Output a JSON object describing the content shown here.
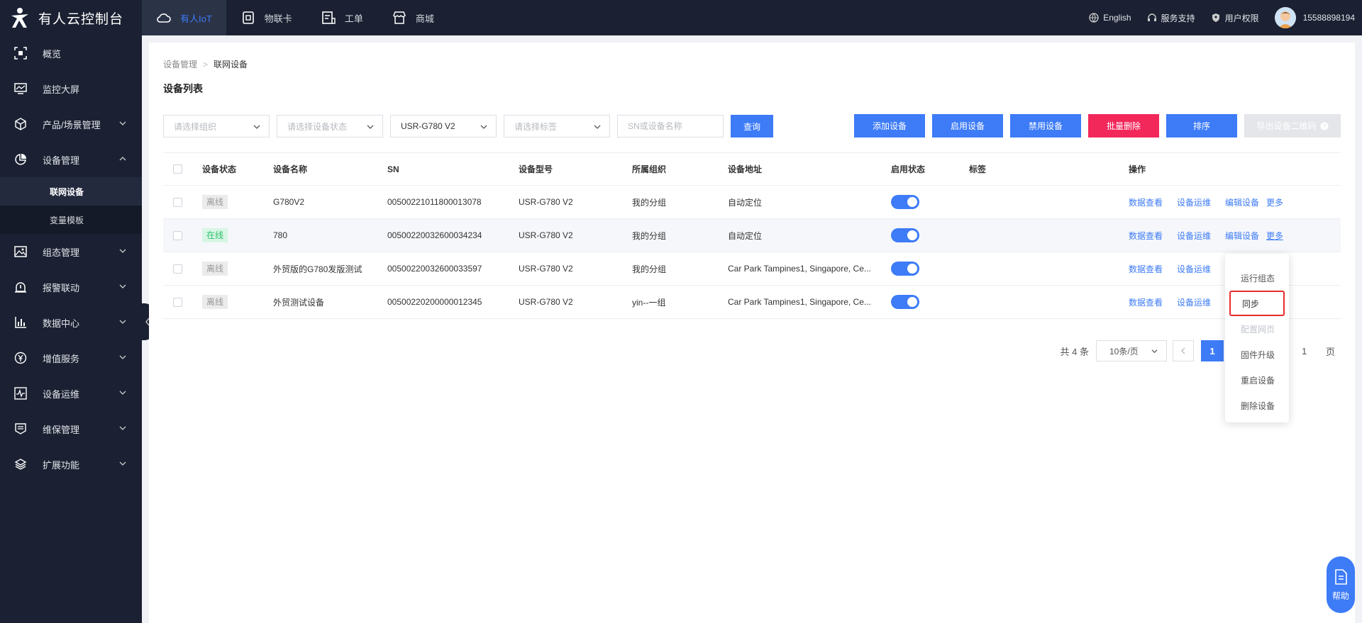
{
  "app": {
    "title": "有人云控制台"
  },
  "topnav": {
    "tabs": [
      {
        "label": "有人IoT",
        "icon": "cloud-icon",
        "active": true
      },
      {
        "label": "物联卡",
        "icon": "sim-card-icon",
        "active": false
      },
      {
        "label": "工单",
        "icon": "ticket-icon",
        "active": false
      },
      {
        "label": "商城",
        "icon": "store-icon",
        "active": false
      }
    ],
    "right": {
      "language": "English",
      "support": "服务支持",
      "permission": "用户权限",
      "user": "15588898194"
    }
  },
  "sidebar": {
    "items": [
      {
        "label": "概览",
        "icon": "overview-icon",
        "expandable": false
      },
      {
        "label": "监控大屏",
        "icon": "monitor-icon",
        "expandable": false
      },
      {
        "label": "产品/场景管理",
        "icon": "cube-icon",
        "expandable": true
      },
      {
        "label": "设备管理",
        "icon": "pie-icon",
        "expandable": true,
        "expanded": true
      },
      {
        "label": "组态管理",
        "icon": "image-icon",
        "expandable": true
      },
      {
        "label": "报警联动",
        "icon": "alarm-icon",
        "expandable": true
      },
      {
        "label": "数据中心",
        "icon": "bar-chart-icon",
        "expandable": true
      },
      {
        "label": "增值服务",
        "icon": "yen-icon",
        "expandable": true
      },
      {
        "label": "设备运维",
        "icon": "pulse-icon",
        "expandable": true
      },
      {
        "label": "维保管理",
        "icon": "maintenance-icon",
        "expandable": true
      },
      {
        "label": "扩展功能",
        "icon": "layers-icon",
        "expandable": true
      }
    ],
    "submenu": [
      {
        "label": "联网设备",
        "active": true
      },
      {
        "label": "变量模板",
        "active": false
      }
    ]
  },
  "breadcrumb": {
    "parent": "设备管理",
    "current": "联网设备"
  },
  "page": {
    "title": "设备列表"
  },
  "filters": {
    "org_placeholder": "请选择组织",
    "status_placeholder": "请选择设备状态",
    "model_value": "USR-G780 V2",
    "tag_placeholder": "请选择标签",
    "search_placeholder": "SN或设备名称",
    "query_label": "查询"
  },
  "actions": {
    "add": "添加设备",
    "enable": "启用设备",
    "disable": "禁用设备",
    "batch_delete": "批量删除",
    "sort": "排序",
    "export_qr": "导出设备二维码"
  },
  "table": {
    "headers": [
      "设备状态",
      "设备名称",
      "SN",
      "设备型号",
      "所属组织",
      "设备地址",
      "启用状态",
      "标签",
      "操作"
    ],
    "rows": [
      {
        "status": "离线",
        "online": false,
        "name": "G780V2",
        "sn": "00500221011800013078",
        "model": "USR-G780 V2",
        "org": "我的分组",
        "address": "自动定位",
        "enabled": true,
        "tag": ""
      },
      {
        "status": "在线",
        "online": true,
        "name": "780",
        "sn": "00500220032600034234",
        "model": "USR-G780 V2",
        "org": "我的分组",
        "address": "自动定位",
        "enabled": true,
        "tag": ""
      },
      {
        "status": "离线",
        "online": false,
        "name": "外贸版的G780发版测试",
        "sn": "00500220032600033597",
        "model": "USR-G780 V2",
        "org": "我的分组",
        "address": "Car Park Tampines1, Singapore, Ce...",
        "enabled": true,
        "tag": ""
      },
      {
        "status": "离线",
        "online": false,
        "name": "外贸测试设备",
        "sn": "00500220200000012345",
        "model": "USR-G780 V2",
        "org": "yin--一组",
        "address": "Car Park Tampines1, Singapore, Ce...",
        "enabled": true,
        "tag": ""
      }
    ],
    "ops": {
      "data": "数据查看",
      "maint": "设备运维",
      "edit": "编辑设备",
      "more": "更多"
    }
  },
  "pager": {
    "total": "共 4 条",
    "page_size": "10条/页",
    "current_page": "1",
    "jump_value": "1",
    "page_suffix": "页"
  },
  "more_menu": {
    "items": [
      {
        "label": "运行组态",
        "disabled": false,
        "highlight": false
      },
      {
        "label": "同步",
        "disabled": false,
        "highlight": true
      },
      {
        "label": "配置网页",
        "disabled": true,
        "highlight": false
      },
      {
        "label": "固件升级",
        "disabled": false,
        "highlight": false
      },
      {
        "label": "重启设备",
        "disabled": false,
        "highlight": false
      },
      {
        "label": "删除设备",
        "disabled": false,
        "highlight": false
      }
    ]
  },
  "help": {
    "label": "帮助"
  },
  "colors": {
    "primary": "#3d7bf7",
    "danger": "#f2275a",
    "dark": "#1b2132",
    "online": "#2bbf6a",
    "highlight_border": "#e82c2c"
  }
}
